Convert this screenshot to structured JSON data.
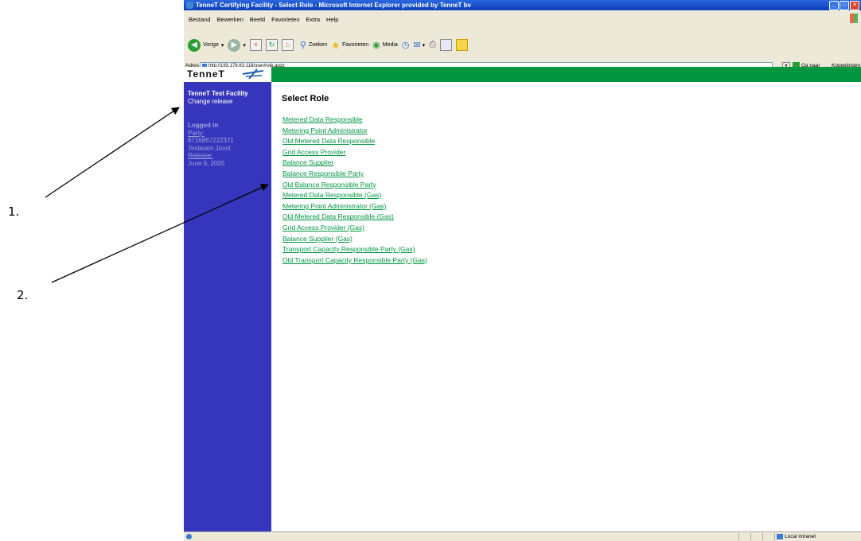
{
  "annotations": {
    "label_1": "1.",
    "label_2": "2."
  },
  "window": {
    "title": "TenneT Certifying Facility - Select Role - Microsoft Internet Explorer provided by TenneT bv",
    "menu": [
      "Bestand",
      "Bewerken",
      "Beeld",
      "Favorieten",
      "Extra",
      "Help"
    ],
    "toolbar": {
      "back": "Vorige",
      "search": "Zoeken",
      "favorites": "Favorieten",
      "media": "Media"
    },
    "address_label": "Adres",
    "address_value": "http://193.176.63.118/user/role.aspx",
    "go_label": "Ga naar",
    "links_label": "Koppelingen",
    "status_zone": "Local intranet"
  },
  "site": {
    "logo_text": "TenneT",
    "sidebar": {
      "facility_title": "TenneT Test Facility",
      "change_release": "Change release",
      "logged_in": "Logged in",
      "party_label": "Party:",
      "party_value": "8716867222371",
      "user": "Testteam Joost",
      "release_label": "Release:",
      "release_value": "June 6, 2005"
    },
    "page_title": "Select Role",
    "roles": [
      "Metered Data Responsible",
      "Metering Point Administrator",
      "Old Metered Data Responsible",
      "Grid Access Provider",
      "Balance Supplier",
      "Balance Responsible Party",
      "Old Balance Responsible Party",
      "Metered Data Responsible (Gas)",
      "Metering Point Administrator (Gas)",
      "Old Metered Data Responsible (Gas)",
      "Grid Access Provider (Gas)",
      "Balance Supplier (Gas)",
      "Transport Capacity Responsible Party (Gas)",
      "Old Transport Capacity Responsible Party (Gas)"
    ]
  },
  "colors": {
    "header_green": "#009640",
    "sidebar_blue": "#3636bc",
    "link_green": "#009640",
    "title_blue": "#0a3fb8"
  }
}
